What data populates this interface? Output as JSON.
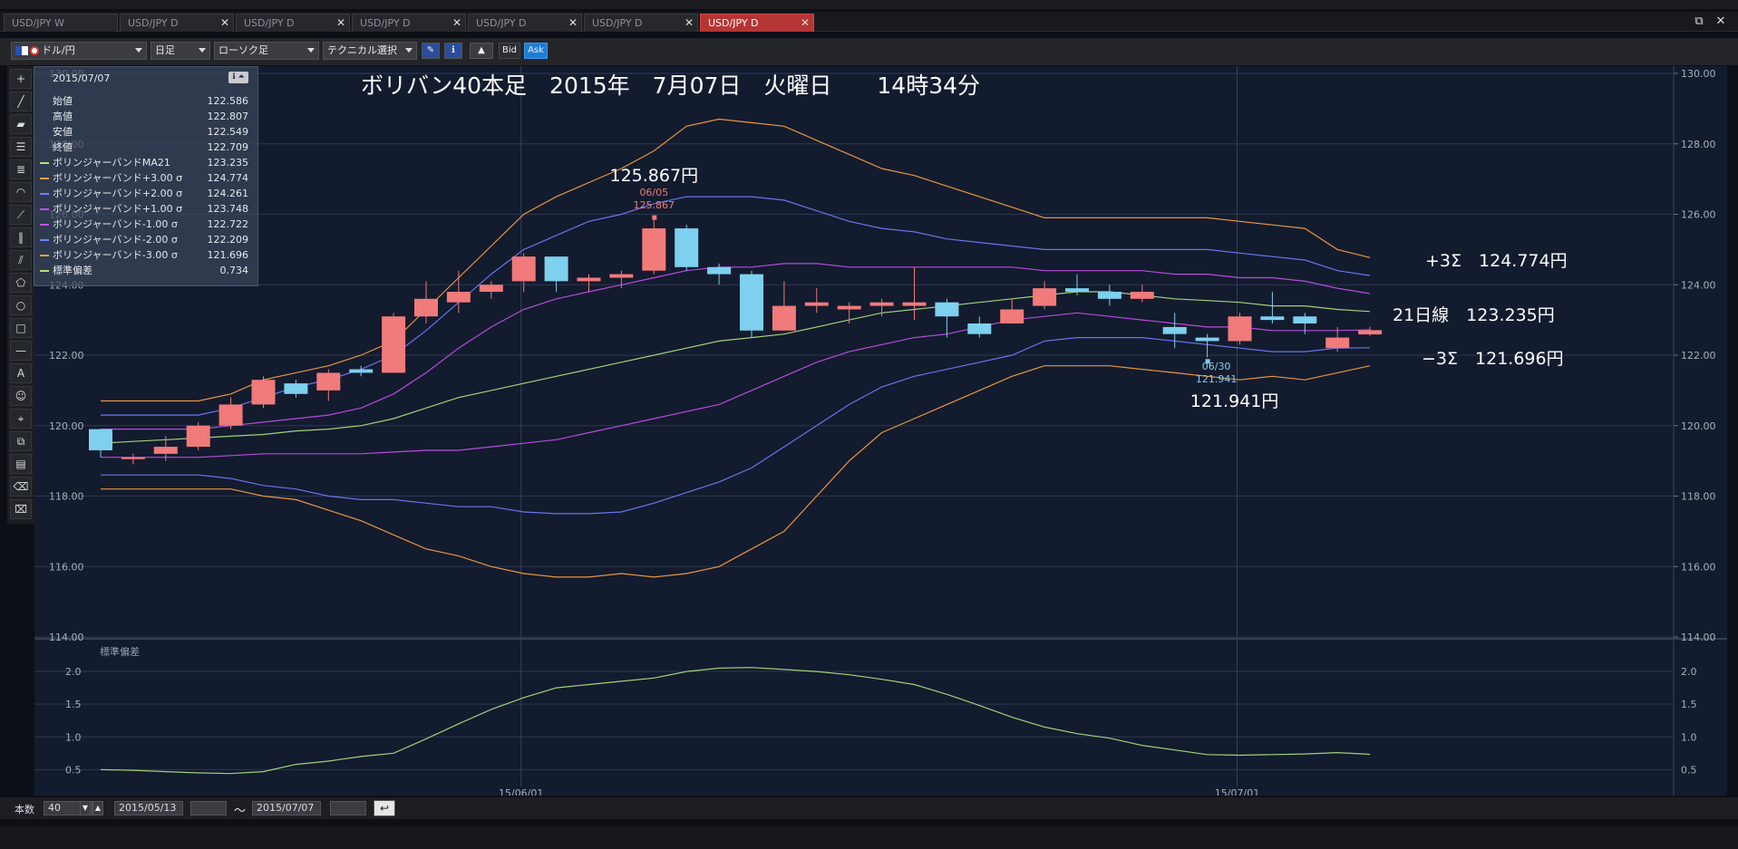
{
  "tabs": [
    {
      "label": "USD/JPY W",
      "active": false
    },
    {
      "label": "USD/JPY D",
      "active": false
    },
    {
      "label": "USD/JPY D",
      "active": false
    },
    {
      "label": "USD/JPY D",
      "active": false
    },
    {
      "label": "USD/JPY D",
      "active": false
    },
    {
      "label": "USD/JPY D",
      "active": false
    },
    {
      "label": "USD/JPY D",
      "active": true
    }
  ],
  "toolbar": {
    "pair": "ドル/円",
    "period": "日足",
    "chart_style": "ローソク足",
    "technical": "テクニカル選択",
    "bid": "Bid",
    "ask": "Ask"
  },
  "title": "ボリバン40本足　2015年　7月07日　火曜日　　14時34分",
  "info": {
    "date": "2015/07/07",
    "rows": [
      {
        "label": "始値",
        "value": "122.586",
        "color": "none"
      },
      {
        "label": "高値",
        "value": "122.807",
        "color": "none"
      },
      {
        "label": "安値",
        "value": "122.549",
        "color": "none"
      },
      {
        "label": "終値",
        "value": "122.709",
        "color": "none"
      },
      {
        "label": "ボリンジャーバンドMA21",
        "value": "123.235",
        "color": "#b4e07a"
      },
      {
        "label": "ボリンジャーバンド+3.00 σ",
        "value": "124.774",
        "color": "#f0a050"
      },
      {
        "label": "ボリンジャーバンド+2.00 σ",
        "value": "124.261",
        "color": "#7080ff"
      },
      {
        "label": "ボリンジャーバンド+1.00 σ",
        "value": "123.748",
        "color": "#c050f0"
      },
      {
        "label": "ボリンジャーバンド-1.00 σ",
        "value": "122.722",
        "color": "#c050f0"
      },
      {
        "label": "ボリンジャーバンド-2.00 σ",
        "value": "122.209",
        "color": "#7080ff"
      },
      {
        "label": "ボリンジャーバンド-3.00 σ",
        "value": "121.696",
        "color": "#f0a050"
      },
      {
        "label": "標準偏差",
        "value": "0.734",
        "color": "#b4e07a"
      }
    ]
  },
  "annotations": {
    "high_price": "125.867円",
    "high_date": "06/05",
    "high_value": "125.867",
    "low_price": "121.941円",
    "low_date": "06/30",
    "low_value": "121.941",
    "plus3": "+3Σ　124.774円",
    "ma21": "21日線　123.235円",
    "minus3": "−3Σ　121.696円"
  },
  "sub_label": "標準偏差",
  "bottom": {
    "count_label": "本数",
    "count": "40",
    "from": "2015/05/13",
    "tilde": "〜",
    "to": "2015/07/07"
  },
  "colors": {
    "up": "#f17a7a",
    "down": "#7dd0ee",
    "ma": "#9fd27a",
    "s3": "#e8963e",
    "s2": "#6a74ee",
    "s1": "#b64cdc"
  },
  "chart_data": {
    "type": "candlestick",
    "y_ticks": [
      "130.00",
      "128.00",
      "126.00",
      "124.00",
      "122.00",
      "120.00",
      "118.00",
      "116.00",
      "114.00"
    ],
    "ylim": [
      114,
      130
    ],
    "x_labels": [
      {
        "label": "15/06/01",
        "index": 13
      },
      {
        "label": "15/07/01",
        "index": 35
      }
    ],
    "sub_ticks": [
      "2.0",
      "1.5",
      "1.0",
      "0.5"
    ],
    "sub_ylim": [
      0.45,
      2.25
    ],
    "candles": [
      [
        119.9,
        119.9,
        119.1,
        119.3
      ],
      [
        119.1,
        119.2,
        118.9,
        119.1
      ],
      [
        119.2,
        119.7,
        119.0,
        119.4
      ],
      [
        119.4,
        120.1,
        119.3,
        120.0
      ],
      [
        120.0,
        120.8,
        119.9,
        120.6
      ],
      [
        120.6,
        121.4,
        120.5,
        121.3
      ],
      [
        121.2,
        121.3,
        120.8,
        120.9
      ],
      [
        121.0,
        121.6,
        120.7,
        121.5
      ],
      [
        121.6,
        121.7,
        121.4,
        121.5
      ],
      [
        121.5,
        123.2,
        121.5,
        123.1
      ],
      [
        123.1,
        124.1,
        122.9,
        123.6
      ],
      [
        123.5,
        124.4,
        123.2,
        123.8
      ],
      [
        123.8,
        124.1,
        123.6,
        124.0
      ],
      [
        124.1,
        124.9,
        123.8,
        124.8
      ],
      [
        124.8,
        124.8,
        123.8,
        124.1
      ],
      [
        124.1,
        124.3,
        123.8,
        124.2
      ],
      [
        124.2,
        124.4,
        123.9,
        124.3
      ],
      [
        124.4,
        125.87,
        124.3,
        125.6
      ],
      [
        125.6,
        125.7,
        124.4,
        124.5
      ],
      [
        124.5,
        124.6,
        124.0,
        124.3
      ],
      [
        124.3,
        124.4,
        122.5,
        122.7
      ],
      [
        122.7,
        124.1,
        122.7,
        123.4
      ],
      [
        123.4,
        123.9,
        123.2,
        123.5
      ],
      [
        123.3,
        123.5,
        122.9,
        123.4
      ],
      [
        123.4,
        123.6,
        123.1,
        123.5
      ],
      [
        123.4,
        124.5,
        123.0,
        123.5
      ],
      [
        123.5,
        123.6,
        122.5,
        123.1
      ],
      [
        122.9,
        123.1,
        122.5,
        122.6
      ],
      [
        122.9,
        123.6,
        122.9,
        123.3
      ],
      [
        123.4,
        124.1,
        123.3,
        123.9
      ],
      [
        123.9,
        124.3,
        123.7,
        123.8
      ],
      [
        123.8,
        124.0,
        123.4,
        123.6
      ],
      [
        123.6,
        124.0,
        123.5,
        123.8
      ],
      [
        122.8,
        123.2,
        122.2,
        122.6
      ],
      [
        122.5,
        122.6,
        121.941,
        122.4
      ],
      [
        122.4,
        123.2,
        122.3,
        123.1
      ],
      [
        123.1,
        123.8,
        122.9,
        123.0
      ],
      [
        123.1,
        123.2,
        122.6,
        122.9
      ],
      [
        122.2,
        122.8,
        122.1,
        122.5
      ],
      [
        122.59,
        122.81,
        122.55,
        122.71
      ]
    ],
    "series": [
      {
        "name": "ボリンジャーバンド+3.00 σ",
        "values": [
          120.7,
          120.7,
          120.7,
          120.7,
          120.9,
          121.3,
          121.5,
          121.7,
          122.0,
          122.4,
          123.3,
          124.2,
          125.1,
          126.0,
          126.5,
          126.9,
          127.3,
          127.8,
          128.5,
          128.7,
          128.6,
          128.5,
          128.1,
          127.7,
          127.3,
          127.1,
          126.8,
          126.5,
          126.2,
          125.9,
          125.9,
          125.9,
          125.9,
          125.9,
          125.9,
          125.8,
          125.7,
          125.6,
          125.0,
          124.77
        ]
      },
      {
        "name": "ボリンジャーバンド+2.00 σ",
        "values": [
          120.3,
          120.3,
          120.3,
          120.3,
          120.5,
          120.8,
          121.1,
          121.3,
          121.6,
          122.0,
          122.7,
          123.5,
          124.3,
          125.0,
          125.4,
          125.8,
          126.0,
          126.3,
          126.5,
          126.5,
          126.5,
          126.4,
          126.1,
          125.8,
          125.6,
          125.5,
          125.3,
          125.2,
          125.1,
          125.0,
          125.0,
          125.0,
          125.0,
          125.0,
          125.0,
          124.9,
          124.8,
          124.7,
          124.4,
          124.26
        ]
      },
      {
        "name": "ボリンジャーバンド+1.00 σ",
        "values": [
          119.9,
          119.9,
          119.9,
          119.9,
          120.0,
          120.1,
          120.2,
          120.3,
          120.5,
          120.9,
          121.5,
          122.2,
          122.8,
          123.3,
          123.6,
          123.8,
          124.0,
          124.2,
          124.4,
          124.5,
          124.5,
          124.6,
          124.6,
          124.5,
          124.5,
          124.5,
          124.5,
          124.5,
          124.5,
          124.4,
          124.4,
          124.4,
          124.4,
          124.3,
          124.3,
          124.2,
          124.2,
          124.1,
          123.9,
          123.75
        ]
      },
      {
        "name": "ボリンジャーバンドMA21",
        "values": [
          119.5,
          119.55,
          119.6,
          119.65,
          119.7,
          119.75,
          119.85,
          119.9,
          120.0,
          120.2,
          120.5,
          120.8,
          121.0,
          121.2,
          121.4,
          121.6,
          121.8,
          122.0,
          122.2,
          122.4,
          122.5,
          122.6,
          122.8,
          123.0,
          123.2,
          123.3,
          123.4,
          123.5,
          123.6,
          123.7,
          123.8,
          123.8,
          123.7,
          123.6,
          123.55,
          123.5,
          123.4,
          123.4,
          123.3,
          123.24
        ]
      },
      {
        "name": "ボリンジャーバンド-1.00 σ",
        "values": [
          119.1,
          119.1,
          119.1,
          119.1,
          119.15,
          119.2,
          119.2,
          119.2,
          119.2,
          119.25,
          119.3,
          119.3,
          119.4,
          119.5,
          119.6,
          119.8,
          120.0,
          120.2,
          120.4,
          120.6,
          121.0,
          121.4,
          121.8,
          122.1,
          122.3,
          122.5,
          122.6,
          122.8,
          123.0,
          123.1,
          123.2,
          123.1,
          123.0,
          122.9,
          122.8,
          122.8,
          122.7,
          122.7,
          122.7,
          122.72
        ]
      },
      {
        "name": "ボリンジャーバンド-2.00 σ",
        "values": [
          118.6,
          118.6,
          118.6,
          118.6,
          118.5,
          118.3,
          118.2,
          118.0,
          117.9,
          117.9,
          117.8,
          117.7,
          117.7,
          117.55,
          117.5,
          117.5,
          117.55,
          117.8,
          118.1,
          118.4,
          118.8,
          119.4,
          120.0,
          120.6,
          121.1,
          121.4,
          121.6,
          121.8,
          122.0,
          122.4,
          122.5,
          122.5,
          122.5,
          122.4,
          122.3,
          122.2,
          122.1,
          122.1,
          122.2,
          122.21
        ]
      },
      {
        "name": "ボリンジャーバンド-3.00 σ",
        "values": [
          118.2,
          118.2,
          118.2,
          118.2,
          118.2,
          118.0,
          117.9,
          117.6,
          117.3,
          116.9,
          116.5,
          116.3,
          116.0,
          115.8,
          115.7,
          115.7,
          115.8,
          115.7,
          115.8,
          116.0,
          116.5,
          117.0,
          118.0,
          119.0,
          119.8,
          120.2,
          120.6,
          121.0,
          121.4,
          121.7,
          121.7,
          121.7,
          121.6,
          121.5,
          121.4,
          121.3,
          121.4,
          121.3,
          121.5,
          121.7
        ]
      },
      {
        "name": "標準偏差",
        "values": [
          0.5,
          0.49,
          0.47,
          0.45,
          0.44,
          0.47,
          0.58,
          0.63,
          0.7,
          0.75,
          0.97,
          1.2,
          1.42,
          1.6,
          1.75,
          1.8,
          1.85,
          1.9,
          2.0,
          2.05,
          2.06,
          2.03,
          2.0,
          1.95,
          1.88,
          1.8,
          1.65,
          1.48,
          1.3,
          1.15,
          1.05,
          0.98,
          0.87,
          0.8,
          0.73,
          0.72,
          0.73,
          0.74,
          0.76,
          0.734
        ]
      }
    ]
  }
}
